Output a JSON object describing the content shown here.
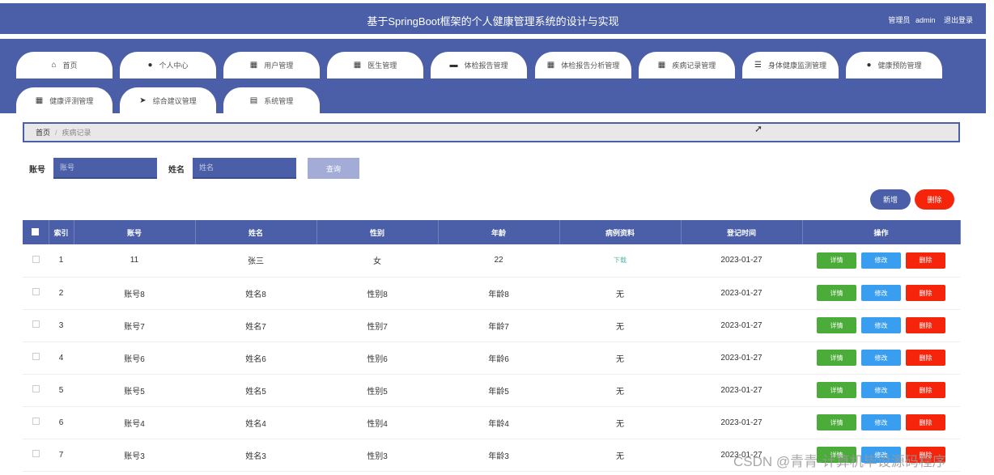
{
  "header": {
    "title": "基于SpringBoot框架的个人健康管理系统的设计与实现",
    "role": "管理员",
    "username": "admin",
    "logout": "退出登录"
  },
  "nav": {
    "tabs": [
      {
        "label": "首页",
        "icon": "home-icon",
        "glyph": "⌂"
      },
      {
        "label": "个人中心",
        "icon": "person-icon",
        "glyph": "●"
      },
      {
        "label": "用户管理",
        "icon": "grid-icon",
        "glyph": "▦"
      },
      {
        "label": "医生管理",
        "icon": "grid-icon",
        "glyph": "▦"
      },
      {
        "label": "体检报告管理",
        "icon": "briefcase-icon",
        "glyph": "▬"
      },
      {
        "label": "体检报告分析管理",
        "icon": "grid-icon",
        "glyph": "▦"
      },
      {
        "label": "疾病记录管理",
        "icon": "grid-icon",
        "glyph": "▦"
      },
      {
        "label": "身体健康监测管理",
        "icon": "filter-icon",
        "glyph": "☰"
      },
      {
        "label": "健康预防管理",
        "icon": "person-icon",
        "glyph": "●"
      },
      {
        "label": "健康评测管理",
        "icon": "grid-icon",
        "glyph": "▦"
      },
      {
        "label": "综合建议管理",
        "icon": "send-icon",
        "glyph": "➤"
      },
      {
        "label": "系统管理",
        "icon": "clipboard-icon",
        "glyph": "▤"
      }
    ]
  },
  "breadcrumb": {
    "home": "首页",
    "separator": "/",
    "current": "疾病记录"
  },
  "search": {
    "account_label": "账号",
    "account_placeholder": "账号",
    "name_label": "姓名",
    "name_placeholder": "姓名",
    "query_button": "查询"
  },
  "actions": {
    "add": "新增",
    "delete": "删除"
  },
  "table": {
    "headers": [
      "索引",
      "账号",
      "姓名",
      "性别",
      "年龄",
      "病例资料",
      "登记时间",
      "操作"
    ],
    "row_buttons": {
      "detail": "详情",
      "edit": "修改",
      "remove": "删除"
    },
    "rows": [
      {
        "index": "1",
        "account": "11",
        "name": "张三",
        "gender": "女",
        "age": "22",
        "record": "下载",
        "date": "2023-01-27"
      },
      {
        "index": "2",
        "account": "账号8",
        "name": "姓名8",
        "gender": "性别8",
        "age": "年龄8",
        "record": "无",
        "date": "2023-01-27"
      },
      {
        "index": "3",
        "account": "账号7",
        "name": "姓名7",
        "gender": "性别7",
        "age": "年龄7",
        "record": "无",
        "date": "2023-01-27"
      },
      {
        "index": "4",
        "account": "账号6",
        "name": "姓名6",
        "gender": "性别6",
        "age": "年龄6",
        "record": "无",
        "date": "2023-01-27"
      },
      {
        "index": "5",
        "account": "账号5",
        "name": "姓名5",
        "gender": "性别5",
        "age": "年龄5",
        "record": "无",
        "date": "2023-01-27"
      },
      {
        "index": "6",
        "account": "账号4",
        "name": "姓名4",
        "gender": "性别4",
        "age": "年龄4",
        "record": "无",
        "date": "2023-01-27"
      },
      {
        "index": "7",
        "account": "账号3",
        "name": "姓名3",
        "gender": "性别3",
        "age": "年龄3",
        "record": "无",
        "date": "2023-01-27"
      }
    ]
  },
  "watermark": "CSDN @青青-计算机毕设源码程序",
  "colors": {
    "primary": "#4a5fa7",
    "danger": "#f5240b",
    "success": "#4cac3a",
    "info": "#3a9ef0"
  }
}
